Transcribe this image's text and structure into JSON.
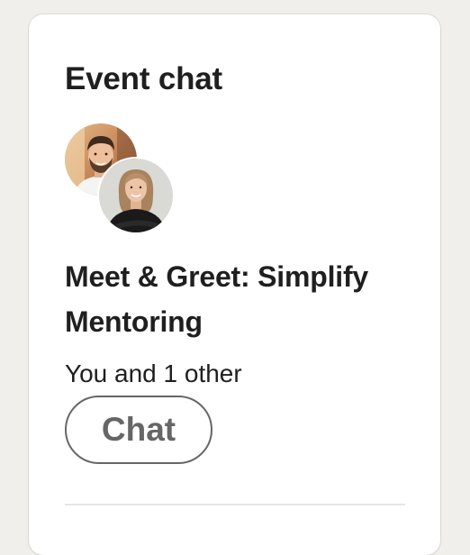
{
  "card": {
    "title": "Event chat",
    "event_name": "Meet & Greet: Simplify Mentoring",
    "participants_text": "You and 1 other",
    "chat_button_label": "Chat"
  },
  "avatars": [
    {
      "icon": "participant-photo-man"
    },
    {
      "icon": "participant-photo-woman"
    }
  ],
  "colors": {
    "page_background": "#f0efeb",
    "card_background": "#ffffff",
    "text": "#1f1f1f",
    "button_border": "#666666",
    "button_text": "#666666"
  }
}
